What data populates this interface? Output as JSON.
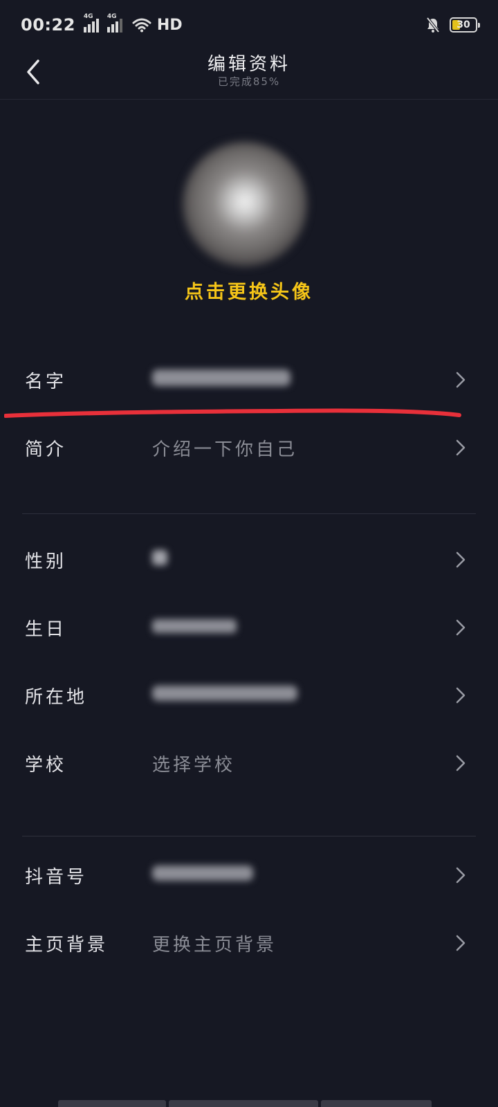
{
  "status_bar": {
    "time": "00:22",
    "network_1": "4G",
    "network_2": "4G",
    "hd": "HD",
    "battery": "30",
    "battery_color": "#e3c21c"
  },
  "nav": {
    "title": "编辑资料",
    "subtitle": "已完成85%"
  },
  "avatar": {
    "change_label": "点击更换头像",
    "accent_color": "#f5c518"
  },
  "rows": [
    {
      "label": "名字",
      "value": " ",
      "blurred": true
    },
    {
      "label": "简介",
      "value": "介绍一下你自己",
      "blurred": false
    },
    {
      "label": "性别",
      "value": " ",
      "blurred": true
    },
    {
      "label": "生日",
      "value": " ",
      "blurred": true
    },
    {
      "label": "所在地",
      "value": " ",
      "blurred": true
    },
    {
      "label": "学校",
      "value": "选择学校",
      "blurred": false
    },
    {
      "label": "抖音号",
      "value": " ",
      "blurred": true
    },
    {
      "label": "主页背景",
      "value": "更换主页背景",
      "blurred": false
    }
  ],
  "colors": {
    "background": "#161823",
    "annotation_red": "#e8303a"
  }
}
